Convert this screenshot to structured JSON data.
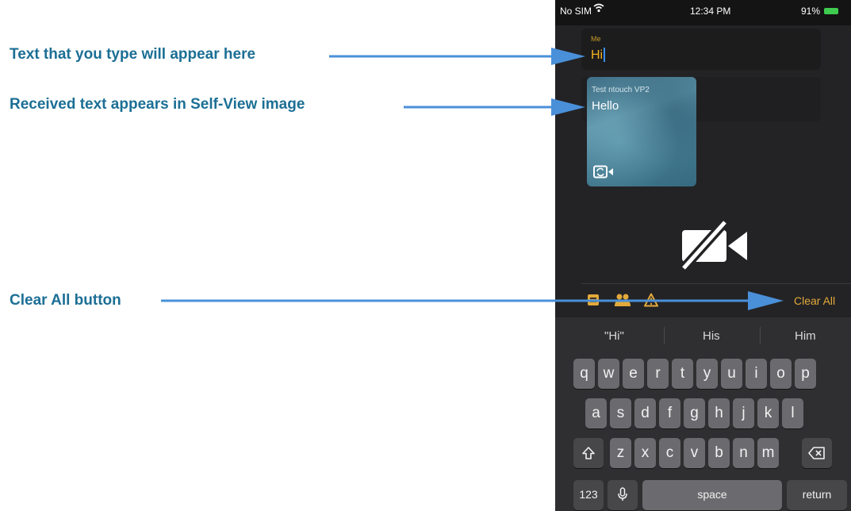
{
  "callouts": {
    "typed": "Text that you type will appear here",
    "received": "Received text appears in Self-View image",
    "clear_all": "Clear All button"
  },
  "status_bar": {
    "carrier": "No SIM",
    "time": "12:34 PM",
    "battery": "91%"
  },
  "conversation": {
    "me_label": "Me",
    "me_text": "Hi",
    "remote_label": "Test ntouch VP2",
    "remote_text": "Hello"
  },
  "toolbar": {
    "clear_all": "Clear All"
  },
  "keyboard": {
    "suggestions": [
      "\"Hi\"",
      "His",
      "Him"
    ],
    "row1": [
      "q",
      "w",
      "e",
      "r",
      "t",
      "y",
      "u",
      "i",
      "o",
      "p"
    ],
    "row2": [
      "a",
      "s",
      "d",
      "f",
      "g",
      "h",
      "j",
      "k",
      "l"
    ],
    "row3": [
      "z",
      "x",
      "c",
      "v",
      "b",
      "n",
      "m"
    ],
    "numbers": "123",
    "space": "space",
    "return": "return"
  },
  "colors": {
    "callout_text": "#1c6f95",
    "arrow": "#4a90d9",
    "accent": "#e3a93a"
  }
}
